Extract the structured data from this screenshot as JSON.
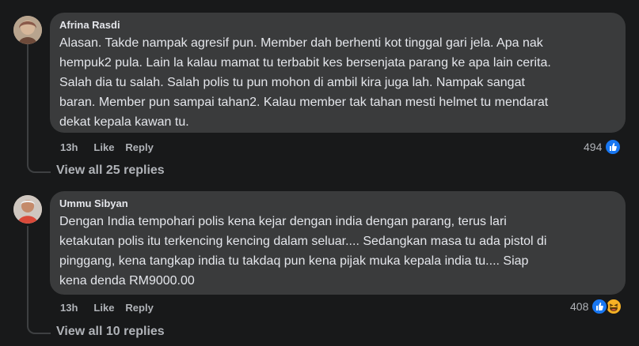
{
  "comments": [
    {
      "author": "Afrina Rasdi",
      "lines": [
        "Alasan. Takde nampak agresif pun. Member dah berhenti kot tinggal gari jela. Apa nak",
        "hempuk2 pula. Lain la kalau mamat tu terbabit kes bersenjata parang ke apa lain cerita.",
        "Salah dia tu salah. Salah polis tu pun mohon di ambil kira juga lah. Nampak sangat",
        "baran. Member pun sampai tahan2. Kalau member tak tahan mesti helmet tu mendarat",
        "dekat kepala kawan tu."
      ],
      "time": "13h",
      "like_label": "Like",
      "reply_label": "Reply",
      "reaction_count": "494",
      "reaction_icons": [
        "like-icon"
      ],
      "view_replies": "View all 25 replies"
    },
    {
      "author": "Ummu Sibyan",
      "lines": [
        "Dengan India tempohari polis kena kejar dengan india dengan parang, terus lari",
        "ketakutan polis itu terkencing kencing dalam seluar.... Sedangkan masa tu ada pistol di",
        "pinggang, kena tangkap india tu takdaq pun kena pijak muka kepala india tu.... Siap",
        "kena denda RM9000.00"
      ],
      "time": "13h",
      "like_label": "Like",
      "reply_label": "Reply",
      "reaction_count": "408",
      "reaction_icons": [
        "like-icon",
        "haha-icon"
      ],
      "view_replies": "View all 10 replies"
    }
  ],
  "colors": {
    "background": "#18191a",
    "bubble": "#3a3b3c",
    "text": "#e4e6eb",
    "muted": "#b0b3b8",
    "like_blue": "#1877f2",
    "haha_yellow": "#f7b125"
  }
}
